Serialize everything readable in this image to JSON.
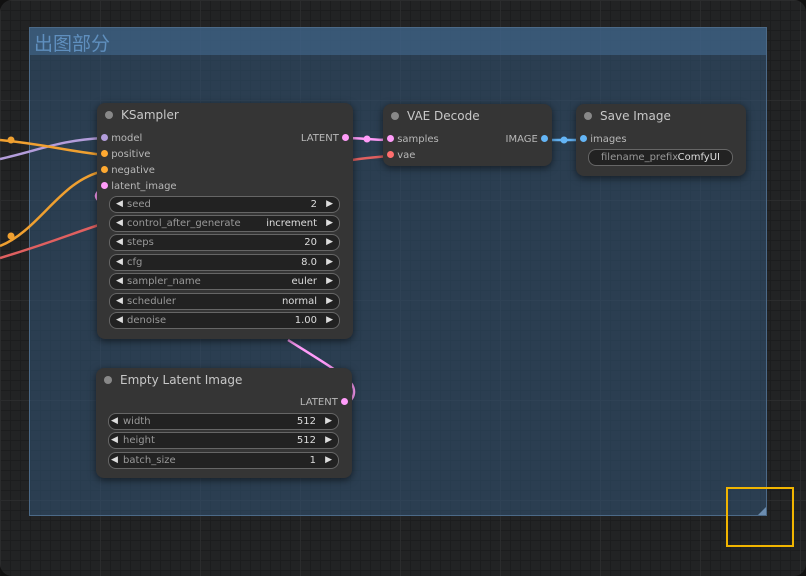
{
  "group": {
    "title": "出图部分",
    "color": "#335577"
  },
  "colors": {
    "model": "#b39ddb",
    "conditioning": "#ffa931",
    "latent": "#ff9cf9",
    "image": "#64b5f6",
    "vae": "#ff6e6e"
  },
  "nodes": {
    "ksampler": {
      "title": "KSampler",
      "inputs": [
        "model",
        "positive",
        "negative",
        "latent_image"
      ],
      "output": "LATENT",
      "widgets": [
        {
          "label": "seed",
          "value": "2"
        },
        {
          "label": "control_after_generate",
          "value": "increment"
        },
        {
          "label": "steps",
          "value": "20"
        },
        {
          "label": "cfg",
          "value": "8.0"
        },
        {
          "label": "sampler_name",
          "value": "euler"
        },
        {
          "label": "scheduler",
          "value": "normal"
        },
        {
          "label": "denoise",
          "value": "1.00"
        }
      ]
    },
    "vae_decode": {
      "title": "VAE Decode",
      "inputs": [
        "samples",
        "vae"
      ],
      "output": "IMAGE"
    },
    "save_image": {
      "title": "Save Image",
      "inputs": [
        "images"
      ],
      "widgets": [
        {
          "label": "filename_prefix",
          "value": "ComfyUI"
        }
      ]
    },
    "empty_latent": {
      "title": "Empty Latent Image",
      "output": "LATENT",
      "widgets": [
        {
          "label": "width",
          "value": "512"
        },
        {
          "label": "height",
          "value": "512"
        },
        {
          "label": "batch_size",
          "value": "1"
        }
      ]
    }
  }
}
